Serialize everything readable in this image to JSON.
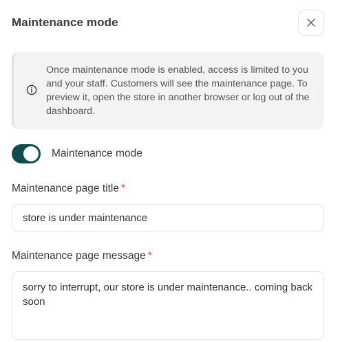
{
  "dialog": {
    "title": "Maintenance mode"
  },
  "info": {
    "icon": "info-circle-icon",
    "text": "Once maintenance mode is enabled, access is limited to you and your staff. Customers will see the maintenance page. To preview it, open the store in another browser or log out of the dashboard."
  },
  "toggle": {
    "label": "Maintenance mode",
    "enabled": true,
    "color": "#0f4c4c"
  },
  "fields": {
    "title": {
      "label": "Maintenance page title",
      "required_mark": "*",
      "value": "store is under maintenance"
    },
    "message": {
      "label": "Maintenance page message",
      "required_mark": "*",
      "value": "sorry to interrupt, our store is under maintenance.. coming back soon"
    }
  },
  "colors": {
    "accent": "#0f4c4c",
    "required": "#e5484d",
    "info_bg": "#f3f3f3"
  }
}
